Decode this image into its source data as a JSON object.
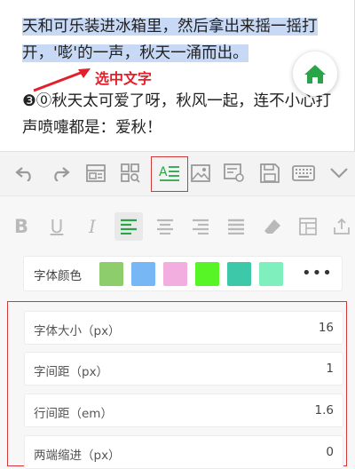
{
  "editor": {
    "para1_selected": "天和可乐装进冰箱里，然后拿出来摇一摇打开，'嘭'的一声，秋天一涌而出。",
    "para1_line1": "天和可乐装进冰箱里，然后拿出来摇一摇打",
    "para1_line2": "开，'嘭'的一声，秋天一涌而出。",
    "para2_line1": "❸⓪秋天太可爱了呀，秋风一起，连不小心打",
    "para2_line2": "声喷嚏都是：爱秋！",
    "annotation": "选中文字",
    "home_icon": "home-icon"
  },
  "toolbar": {
    "icons": [
      "undo-icon",
      "redo-icon",
      "layout-icon",
      "grid-search-icon",
      "text-format-icon",
      "image-icon",
      "doc-settings-icon",
      "save-icon",
      "keyboard-icon",
      "chevron-down-icon"
    ]
  },
  "format": {
    "buttons": [
      {
        "label": "B",
        "name": "bold-button"
      },
      {
        "label": "U",
        "name": "underline-button"
      },
      {
        "label": "I",
        "name": "italic-button"
      },
      {
        "label": "",
        "name": "align-left-button"
      },
      {
        "label": "",
        "name": "align-center-button"
      },
      {
        "label": "",
        "name": "align-right-button"
      },
      {
        "label": "",
        "name": "align-justify-button"
      },
      {
        "label": "",
        "name": "eraser-button"
      },
      {
        "label": "",
        "name": "table-button"
      },
      {
        "label": "",
        "name": "share-button"
      }
    ]
  },
  "font_color": {
    "label": "字体颜色",
    "swatches": [
      "#8dcd6c",
      "#78b7f5",
      "#f3aee0",
      "#58f526",
      "#3ec8aa",
      "#7ff0bd"
    ],
    "more": "•••"
  },
  "settings": {
    "font_size": {
      "label": "字体大小（px）",
      "value": "16"
    },
    "letter_spacing": {
      "label": "字间距（px）",
      "value": "1"
    },
    "line_height": {
      "label": "行间距（em）",
      "value": "1.6"
    },
    "indent": {
      "label": "两端缩进（px）",
      "value": "0"
    }
  },
  "colors": {
    "accent_green": "#2aa448",
    "annotation_red": "#e0202a",
    "selection": "#c7d9f5"
  }
}
